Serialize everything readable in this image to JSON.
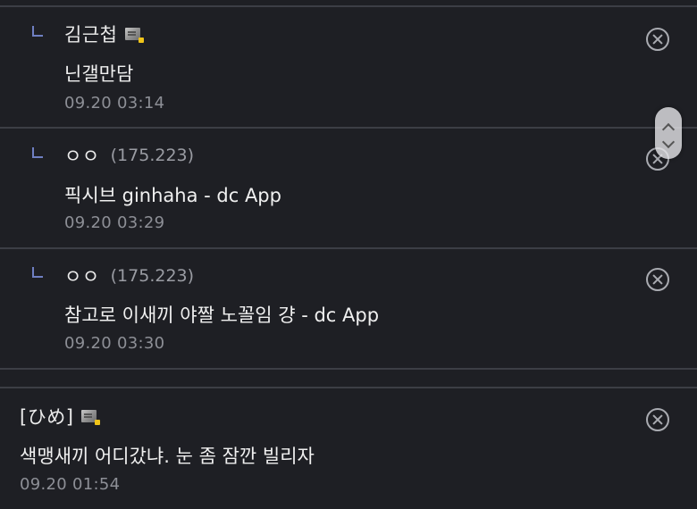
{
  "comments": [
    {
      "nickname": "김근첩",
      "ip": "",
      "badge": "fixed-nick-icon",
      "text": "닌갤만담",
      "time": "09.20 03:14",
      "is_reply": true
    },
    {
      "nickname": "ㅇㅇ",
      "ip": "(175.223)",
      "badge": "",
      "text": "픽시브 ginhaha - dc App",
      "time": "09.20 03:29",
      "is_reply": true
    },
    {
      "nickname": "ㅇㅇ",
      "ip": "(175.223)",
      "badge": "",
      "text": "참고로 이새끼 야짤 노꼴임 걍 - dc App",
      "time": "09.20 03:30",
      "is_reply": true
    },
    {
      "nickname": "[ひめ]",
      "ip": "",
      "badge": "fixed-nick-icon",
      "text": "색맹새끼 어디갔냐. 눈 좀 잠깐 빌리자",
      "time": "09.20 01:54",
      "is_reply": false
    }
  ],
  "colors": {
    "background": "#1e1f24",
    "divider": "#3c3e45",
    "reply_marker": "#6f7fc2",
    "text": "#f0f0f0",
    "meta": "#8d8f96"
  },
  "icons": {
    "delete": "circle-x-icon",
    "reply": "reply-corner-icon",
    "scroll_up": "chevron-up-icon",
    "scroll_down": "chevron-down-icon"
  }
}
